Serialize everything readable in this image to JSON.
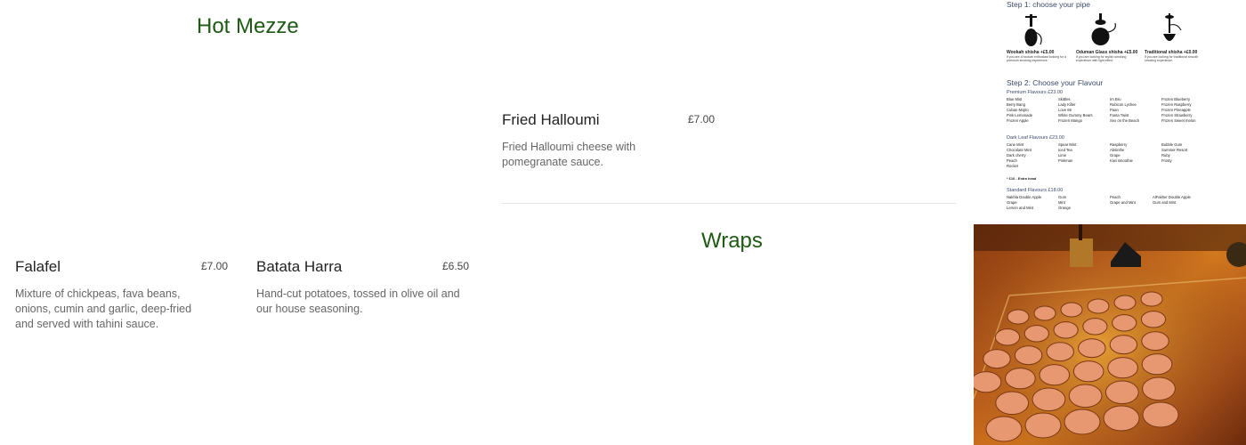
{
  "sections": {
    "hot_mezze": "Hot Mezze",
    "wraps": "Wraps"
  },
  "items": {
    "halloumi": {
      "name": "Fried Halloumi",
      "price": "£7.00",
      "desc": "Fried Halloumi cheese with pomegranate sauce."
    },
    "falafel": {
      "name": "Falafel",
      "price": "£7.00",
      "desc": "Mixture of chickpeas, fava beans, onions, cumin and garlic, deep-fried and served with tahini sauce."
    },
    "batata": {
      "name": "Batata Harra",
      "price": "£6.50",
      "desc": "Hand-cut potatoes, tossed in olive oil and our house seasoning."
    }
  },
  "shisha": {
    "step1": "Step 1: choose your pipe",
    "pipes": [
      {
        "name": "Wookah shisha +£5.00",
        "desc": "If you are a hookah enthusiast looking for a premium smoking experience."
      },
      {
        "name": "Oduman Glass shisha +£5.00",
        "desc": "If you are looking for stylish smoking experience with light effect."
      },
      {
        "name": "Traditional shisha +£0.00",
        "desc": "If you are looking for traditional smooth smoking experience."
      }
    ],
    "step2": "Step 2: Choose your Flavour",
    "premium_title": "Premium Flavours £23.00",
    "premium": [
      [
        "Blue Mist",
        "Berry Bang",
        "Cuban Mojito",
        "Pink Lemonade",
        "Frozen Apple"
      ],
      [
        "Skittles",
        "Lady Killer",
        "Love 66",
        "White Gummy Bears",
        "Frozen Mango"
      ],
      [
        "Irn Bru",
        "Rubicon Lychee",
        "Paan",
        "Fanta Twist",
        "Sex on the Beach"
      ],
      [
        "Frozen Blueberry",
        "Frozen Raspberry",
        "Frozen Pineapple",
        "Frozen Strawberry",
        "Frozen Sweet melon"
      ]
    ],
    "dark_title": "Dark Leaf Flavours £23.00",
    "dark": [
      [
        "Cane Mint",
        "Chocolate Mint",
        "Dark cherry",
        "Peach",
        "Rocket"
      ],
      [
        "Spear Mint",
        "Iced Tea",
        "Lime",
        "Pinkman"
      ],
      [
        "Raspberry",
        "Absinthe",
        "Grape",
        "Kiwi smoothie"
      ],
      [
        "Bubble Gum",
        "Summer Resort",
        "Ruby",
        "Frosty"
      ]
    ],
    "extra": "* £10 - Extra head",
    "standard_title": "Standard Flavours £18.00",
    "standard": [
      [
        "Nakhla Double Apple",
        "Grape",
        "Lemon and Mint"
      ],
      [
        "Gum",
        "Mint",
        "Orange"
      ],
      [
        "Peach",
        "Grape and Mint"
      ],
      [
        "AlFakher Double Apple",
        "Gum and Mint"
      ]
    ]
  },
  "colors": {
    "section_title": "#1e5a14",
    "text": "#222222",
    "muted": "#666666"
  }
}
